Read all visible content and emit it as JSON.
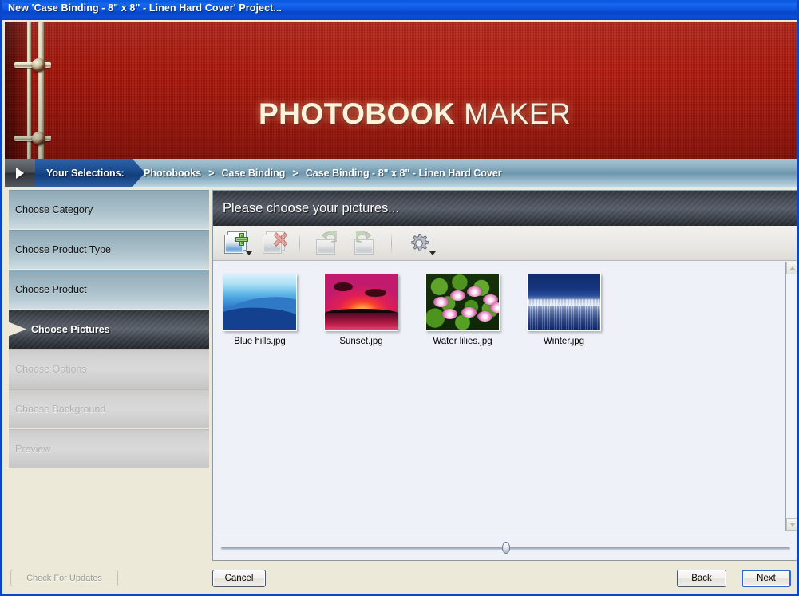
{
  "window": {
    "title": "New 'Case Binding - 8\" x 8\" - Linen Hard Cover' Project..."
  },
  "banner": {
    "brand_bold": "PHOTOBOOK",
    "brand_thin": " MAKER",
    "accent_color": "#a81408"
  },
  "breadcrumb": {
    "home_icon": "play-triangle-icon",
    "label": "Your Selections:",
    "separator": ">",
    "items": [
      {
        "label": "Photobooks"
      },
      {
        "label": "Case Binding"
      },
      {
        "label": "Case Binding - 8\" x 8\" - Linen Hard Cover"
      }
    ]
  },
  "sidebar": {
    "steps": [
      {
        "label": "Choose Category",
        "state": "done"
      },
      {
        "label": "Choose Product Type",
        "state": "done"
      },
      {
        "label": "Choose Product",
        "state": "done"
      },
      {
        "label": "Choose Pictures",
        "state": "active"
      },
      {
        "label": "Choose Options",
        "state": "disabled"
      },
      {
        "label": "Choose Background",
        "state": "disabled"
      },
      {
        "label": "Preview",
        "state": "disabled"
      }
    ],
    "check_updates_label": "Check For Updates"
  },
  "panel": {
    "heading": "Please choose your pictures...",
    "toolbar": [
      {
        "name": "add-pictures-button",
        "icon": "add-picture-icon",
        "enabled": true,
        "has_dropdown": true
      },
      {
        "name": "remove-pictures-button",
        "icon": "remove-picture-icon",
        "enabled": false,
        "has_dropdown": false
      },
      {
        "name": "rotate-left-button",
        "icon": "rotate-left-icon",
        "enabled": false,
        "has_dropdown": false
      },
      {
        "name": "rotate-right-button",
        "icon": "rotate-right-icon",
        "enabled": false,
        "has_dropdown": false
      },
      {
        "name": "settings-button",
        "icon": "gear-icon",
        "enabled": true,
        "has_dropdown": true
      }
    ],
    "pictures": [
      {
        "caption": "Blue hills.jpg",
        "thumb": "img-bluehills"
      },
      {
        "caption": "Sunset.jpg",
        "thumb": "img-sunset"
      },
      {
        "caption": "Water lilies.jpg",
        "thumb": "img-lilies"
      },
      {
        "caption": "Winter.jpg",
        "thumb": "img-winter"
      }
    ],
    "zoom_slider": {
      "name": "thumbnail-size-slider",
      "position_percent": 50
    }
  },
  "footer": {
    "cancel_label": "Cancel",
    "back_label": "Back",
    "next_label": "Next"
  }
}
